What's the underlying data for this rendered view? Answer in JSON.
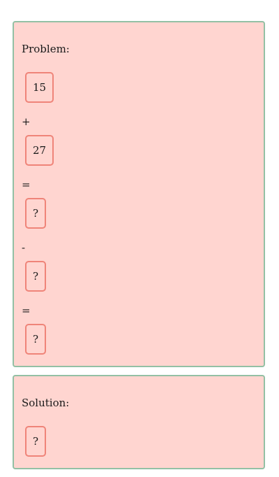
{
  "problem": {
    "label": "Problem:",
    "operand1": "15",
    "op1": "+",
    "operand2": "27",
    "eq1": "=",
    "answer1": "?",
    "op2": "-",
    "operand3": "?",
    "eq2": "=",
    "answer2": "?"
  },
  "solution": {
    "label": "Solution:",
    "answer": "?"
  },
  "colors": {
    "card_background": "#ffd5d0",
    "card_border": "#93c0a4",
    "box_border": "#ef8479"
  }
}
